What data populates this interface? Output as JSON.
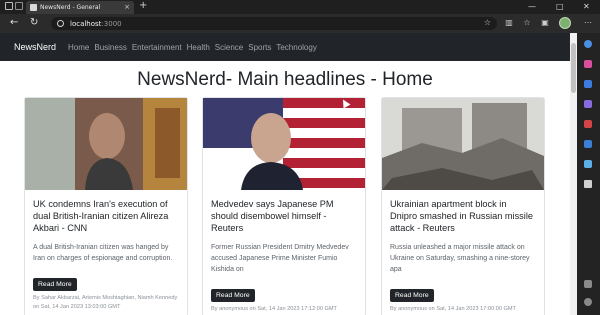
{
  "browser": {
    "tab_title": "NewsNerd - General",
    "url_host": "localhost",
    "url_port": ":3000"
  },
  "navbar": {
    "brand": "NewsNerd",
    "links": [
      "Home",
      "Business",
      "Entertainment",
      "Health",
      "Science",
      "Sports",
      "Technology"
    ]
  },
  "page": {
    "headline": "NewsNerd- Main headlines - Home"
  },
  "cards": [
    {
      "title": "UK condemns Iran's execution of dual British-Iranian citizen Alireza Akbari - CNN",
      "description": "A dual British-Iranian citizen was hanged by Iran on charges of espionage and corruption.",
      "button": "Read More",
      "meta": "By Sahar Akbarzai, Artemis Moshtaghian, Niamh Kennedy on Sat, 14 Jan 2023 13:03:00 GMT"
    },
    {
      "title": "Medvedev says Japanese PM should disembowel himself - Reuters",
      "description": "Former Russian President Dmitry Medvedev accused Japanese Prime Minister Fumio Kishida on",
      "button": "Read More",
      "meta": "By anonymous on Sat, 14 Jan 2023 17:12:00 GMT"
    },
    {
      "title": "Ukrainian apartment block in Dnipro smashed in Russian missile attack - Reuters",
      "description": "Russia unleashed a major missile attack on Ukraine on Saturday, smashing a nine-storey apa",
      "button": "Read More",
      "meta": "By anonymous on Sat, 14 Jan 2023 17:00:00 GMT"
    }
  ]
}
